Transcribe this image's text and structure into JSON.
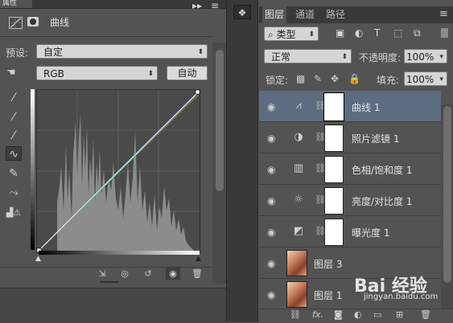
{
  "properties": {
    "tab_label": "属性",
    "header_title": "曲线",
    "preset_label": "预设:",
    "preset_value": "自定",
    "channel_value": "RGB",
    "auto_button": "自动"
  },
  "layers_panel": {
    "tabs": [
      "图层",
      "通道",
      "路径"
    ],
    "filter_kind": "类型",
    "blend_mode": "正常",
    "opacity_label": "不透明度:",
    "opacity_value": "100%",
    "lock_label": "锁定:",
    "fill_label": "填充:",
    "fill_value": "100%",
    "layers": [
      {
        "name": "曲线 1",
        "type": "curves",
        "selected": true
      },
      {
        "name": "照片滤镜 1",
        "type": "photo-filter",
        "selected": false
      },
      {
        "name": "色相/饱和度 1",
        "type": "hue-saturation",
        "selected": false
      },
      {
        "name": "亮度/对比度 1",
        "type": "brightness-contrast",
        "selected": false
      },
      {
        "name": "曝光度 1",
        "type": "exposure",
        "selected": false
      },
      {
        "name": "图层 3",
        "type": "pixel",
        "selected": false
      },
      {
        "name": "图层 1",
        "type": "pixel",
        "selected": false
      }
    ]
  },
  "watermark": {
    "logo_text": "Bai 经验",
    "site": "jingyan.baidu.com"
  },
  "colors": {
    "panel_bg": "#535353",
    "selected_layer": "#5d6c80",
    "curve_blue": "#3a55ff",
    "curve_green": "#3ec23e",
    "curve_red": "#d23a3a"
  }
}
